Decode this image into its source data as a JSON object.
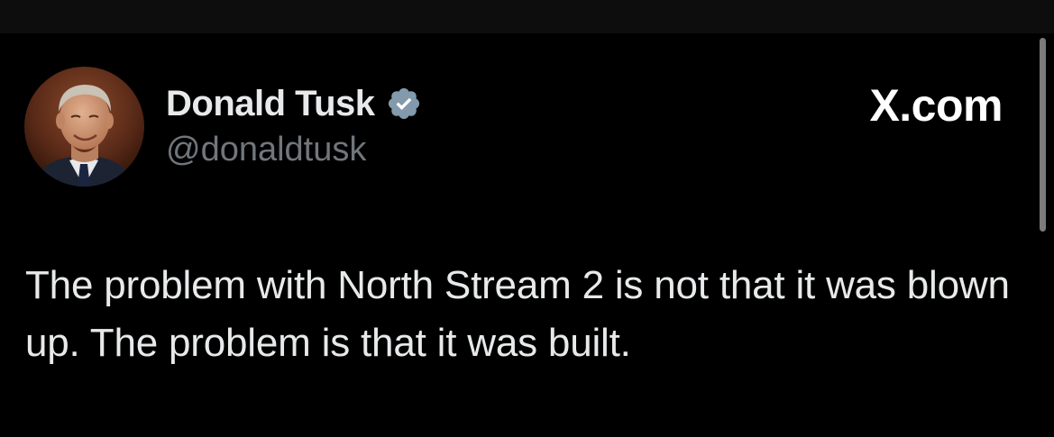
{
  "tweet": {
    "author": {
      "display_name": "Donald Tusk",
      "handle": "@donaldtusk",
      "verified": true,
      "avatar": "profile-photo"
    },
    "brand_label": "X.com",
    "text": "The problem with North Stream 2 is not that it was blown up. The problem is that it was built."
  },
  "colors": {
    "background": "#000000",
    "top_bar": "#0d0d0d",
    "primary_text": "#e7e9ea",
    "secondary_text": "#71767b",
    "verified_badge": "#829aab"
  },
  "icons": {
    "verified": "verified-badge-icon"
  }
}
